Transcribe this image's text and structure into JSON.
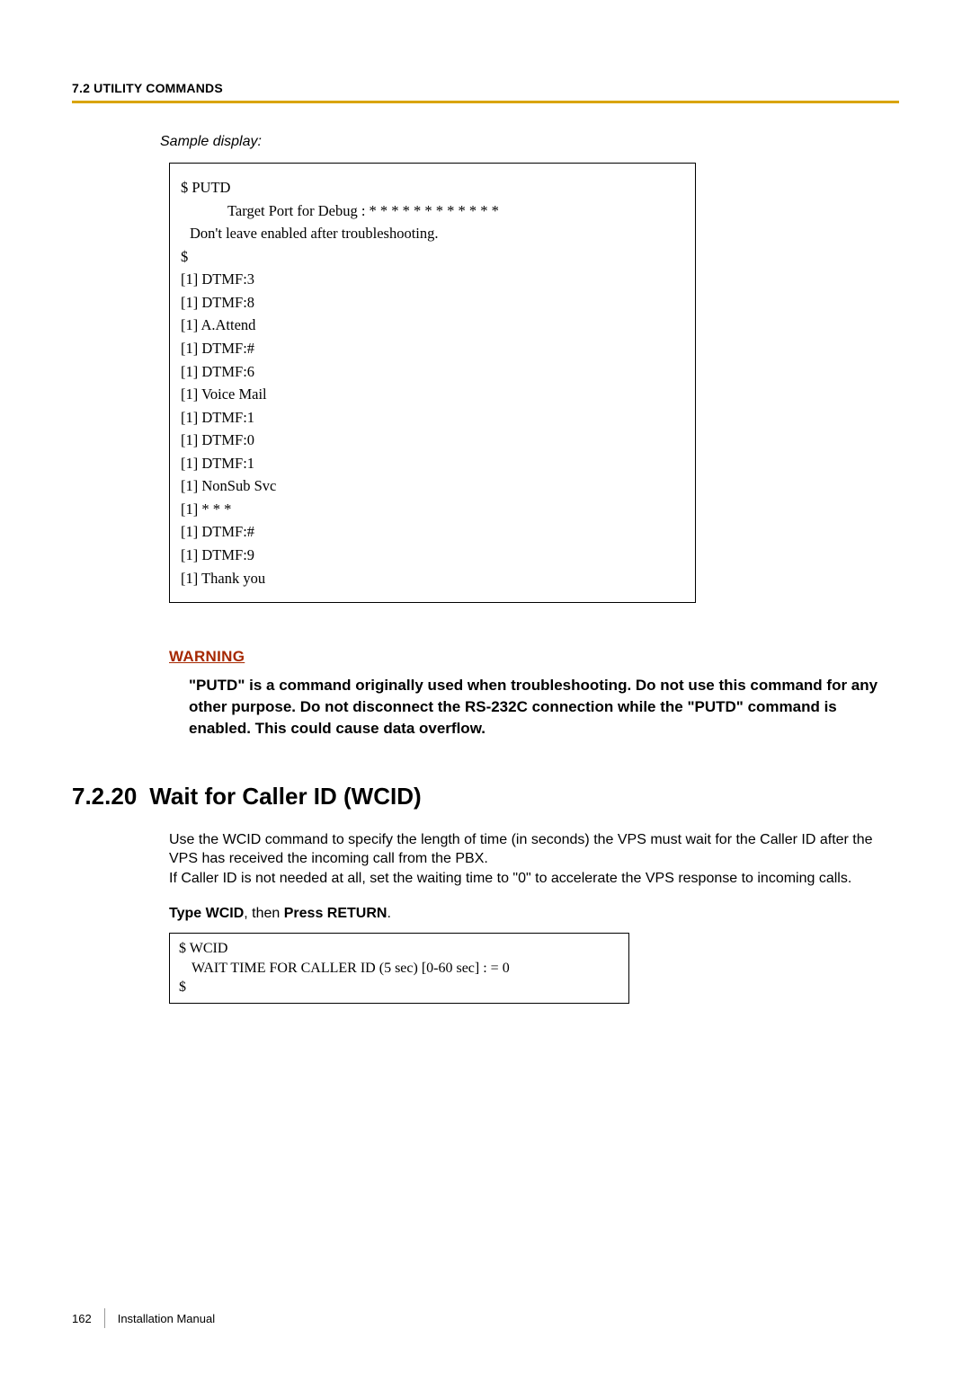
{
  "header": {
    "section": "7.2 UTILITY COMMANDS"
  },
  "sample": {
    "label": "Sample display:",
    "lines": [
      {
        "text": "$ PUTD",
        "cls": ""
      },
      {
        "text": "Target Port for Debug :   * * * *   * * * *   * * * *",
        "cls": "indent1"
      },
      {
        "text": "Don't leave enabled after troubleshooting.",
        "cls": "indent-small"
      },
      {
        "text": "$",
        "cls": ""
      },
      {
        "text": "[1] DTMF:3",
        "cls": ""
      },
      {
        "text": "[1] DTMF:8",
        "cls": ""
      },
      {
        "text": "[1] A.Attend",
        "cls": ""
      },
      {
        "text": "[1] DTMF:#",
        "cls": ""
      },
      {
        "text": "[1] DTMF:6",
        "cls": ""
      },
      {
        "text": "[1] Voice Mail",
        "cls": ""
      },
      {
        "text": "[1] DTMF:1",
        "cls": ""
      },
      {
        "text": "[1] DTMF:0",
        "cls": ""
      },
      {
        "text": "[1] DTMF:1",
        "cls": ""
      },
      {
        "text": "[1] NonSub Svc",
        "cls": ""
      },
      {
        "text": "[1] *  *  *",
        "cls": ""
      },
      {
        "text": "[1] DTMF:#",
        "cls": ""
      },
      {
        "text": "[1] DTMF:9",
        "cls": ""
      },
      {
        "text": "[1] Thank you",
        "cls": ""
      }
    ]
  },
  "warning": {
    "title": "WARNING",
    "text": "\"PUTD\" is a command originally used when troubleshooting. Do not use this command for any other purpose. Do not disconnect the RS-232C connection while the \"PUTD\" command is enabled. This could cause data overflow."
  },
  "heading": {
    "number": "7.2.20",
    "title": "Wait for Caller ID (WCID)"
  },
  "paragraph": "Use the WCID command to specify the length of time (in seconds) the VPS must wait for the Caller ID after the VPS has received the incoming call from the PBX.\nIf Caller ID is not needed at all, set the waiting time to \"0\" to accelerate the VPS response to incoming calls.",
  "instruction": {
    "pre": "Type WCID",
    "mid": ", then ",
    "post": "Press RETURN",
    "end": "."
  },
  "wcid_box": {
    "lines": [
      {
        "text": "$ WCID",
        "cls": ""
      },
      {
        "text": "WAIT TIME FOR CALLER ID (5 sec) [0-60 sec] : = 0",
        "cls": "indent1"
      },
      {
        "text": "$",
        "cls": ""
      }
    ]
  },
  "footer": {
    "page": "162",
    "label": "Installation Manual"
  }
}
